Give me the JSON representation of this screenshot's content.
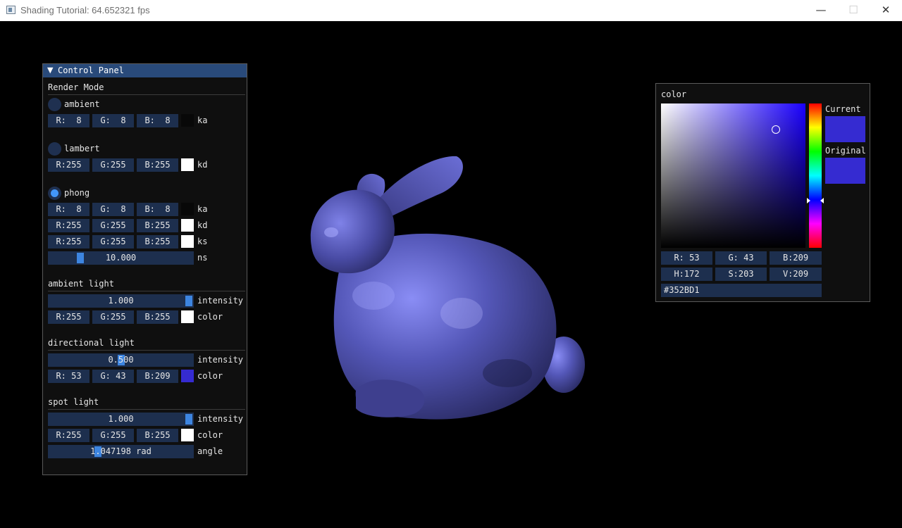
{
  "window": {
    "title": "Shading Tutorial: 64.652321 fps",
    "min": "—",
    "max": "☐",
    "close": "✕"
  },
  "panel": {
    "title": "Control Panel",
    "render_mode": "Render Mode",
    "ambient": {
      "label": "ambient",
      "selected": false,
      "ka": {
        "r": "R:  8",
        "g": "G:  8",
        "b": "B:  8",
        "color": "#080808",
        "label": "ka"
      }
    },
    "lambert": {
      "label": "lambert",
      "selected": false,
      "kd": {
        "r": "R:255",
        "g": "G:255",
        "b": "B:255",
        "color": "#ffffff",
        "label": "kd"
      }
    },
    "phong": {
      "label": "phong",
      "selected": true,
      "ka": {
        "r": "R:  8",
        "g": "G:  8",
        "b": "B:  8",
        "color": "#080808",
        "label": "ka"
      },
      "kd": {
        "r": "R:255",
        "g": "G:255",
        "b": "B:255",
        "color": "#ffffff",
        "label": "kd"
      },
      "ks": {
        "r": "R:255",
        "g": "G:255",
        "b": "B:255",
        "color": "#ffffff",
        "label": "ks"
      },
      "ns": {
        "value": "10.000",
        "fraction": 0.2,
        "label": "ns"
      }
    },
    "ambient_light": {
      "header": "ambient light",
      "intensity": {
        "value": "1.000",
        "fraction": 1.0,
        "label": "intensity"
      },
      "color": {
        "r": "R:255",
        "g": "G:255",
        "b": "B:255",
        "color": "#ffffff",
        "label": "color"
      }
    },
    "directional_light": {
      "header": "directional light",
      "intensity": {
        "value": "0.500",
        "fraction": 0.5,
        "label": "intensity"
      },
      "color": {
        "r": "R: 53",
        "g": "G: 43",
        "b": "B:209",
        "color": "#352bd1",
        "label": "color"
      }
    },
    "spot_light": {
      "header": "spot light",
      "intensity": {
        "value": "1.000",
        "fraction": 1.0,
        "label": "intensity"
      },
      "color": {
        "r": "R:255",
        "g": "G:255",
        "b": "B:255",
        "color": "#ffffff",
        "label": "color"
      },
      "angle": {
        "value": "1.047198 rad",
        "fraction": 0.33,
        "label": "angle"
      }
    }
  },
  "picker": {
    "title": "color",
    "current_label": "Current",
    "original_label": "Original",
    "current_color": "#352bd1",
    "original_color": "#352bd1",
    "hue_fraction": 0.675,
    "saturation": 0.796,
    "value": 0.82,
    "r": "R: 53",
    "g": "G: 43",
    "b": "B:209",
    "h": "H:172",
    "s": "S:203",
    "v": "V:209",
    "hex": "#352BD1"
  }
}
